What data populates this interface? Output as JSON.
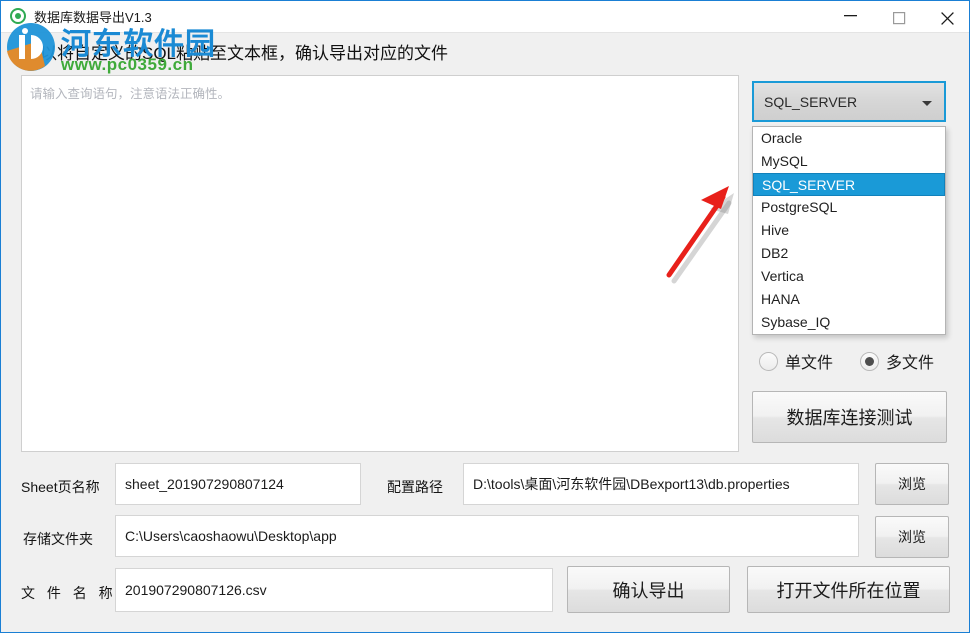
{
  "window": {
    "title": "数据库数据导出V1.3",
    "icon": "app-circle-icon",
    "controls": {
      "minimize": "minimize-icon",
      "maximize": "maximize-icon",
      "close": "close-icon"
    }
  },
  "header": {
    "instruction": "可以将自定义的SQL粘贴至文本框，确认导出对应的文件"
  },
  "watermark": {
    "site_name": "河东软件园",
    "url": "www.pc0359.cn",
    "name_color": "#1a8ad4",
    "url_color": "#3faa3a"
  },
  "sql_editor": {
    "placeholder": "请输入查询语句，注意语法正确性。",
    "value": ""
  },
  "db_select": {
    "label": "database-type",
    "value": "SQL_SERVER",
    "expanded": true,
    "arrow_icon": "chevron-down-icon",
    "focus_color": "#1a9ad7",
    "highlight_color": "#1a9ad7",
    "options": [
      "Oracle",
      "MySQL",
      "SQL_SERVER",
      "PostgreSQL",
      "Hive",
      "DB2",
      "Vertica",
      "HANA",
      "Sybase_IQ"
    ],
    "selected_index": 2
  },
  "file_mode": {
    "single_label": "单文件",
    "multi_label": "多文件",
    "selected": "多文件"
  },
  "actions": {
    "connection_test": "数据库连接测试",
    "browse": "浏览",
    "export": "确认导出",
    "open_location": "打开文件所在位置"
  },
  "form": {
    "sheet": {
      "label": "Sheet页名称",
      "value": "sheet_201907290807124"
    },
    "config_path": {
      "label": "配置路径",
      "value": "D:\\tools\\桌面\\河东软件园\\DBexport13\\db.properties"
    },
    "folder": {
      "label": "存储文件夹",
      "value": "C:\\Users\\caoshaowu\\Desktop\\app"
    },
    "filename": {
      "label": "文 件 名 称",
      "value": "201907290807126.csv"
    }
  },
  "annotation": {
    "arrow": "red-arrow-pointing-to-dropdown",
    "color": "#e8201a"
  }
}
